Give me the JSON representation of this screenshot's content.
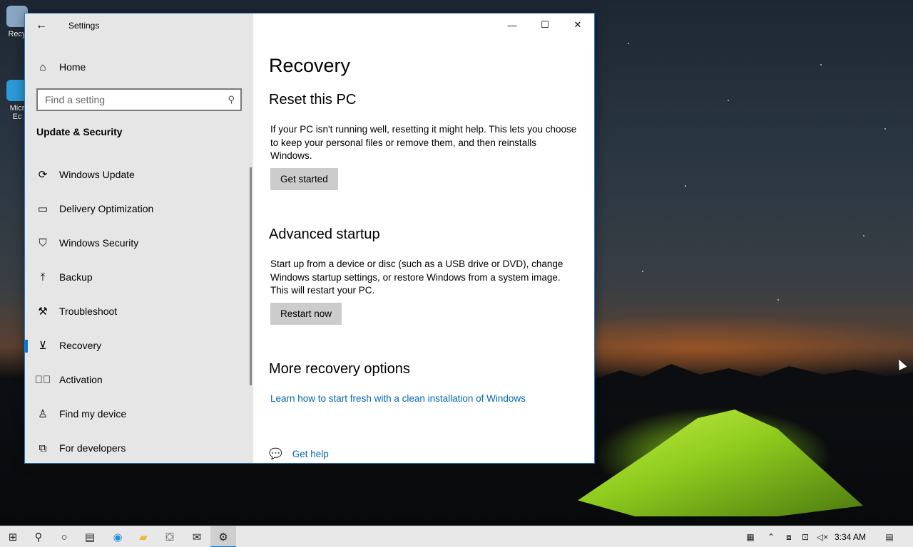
{
  "desktop": {
    "icons": [
      {
        "label": "Recy",
        "icon": "recycle-bin-icon"
      },
      {
        "label": "Micr Ec",
        "icon": "edge-shortcut-icon"
      }
    ]
  },
  "window": {
    "title": "Settings",
    "back_icon": "back-arrow-icon",
    "controls": {
      "minimize": "—",
      "maximize": "☐",
      "close": "✕"
    }
  },
  "sidebar": {
    "home_label": "Home",
    "search_placeholder": "Find a setting",
    "section_title": "Update & Security",
    "items": [
      {
        "label": "Windows Update",
        "icon": "sync-icon",
        "active": false
      },
      {
        "label": "Delivery Optimization",
        "icon": "delivery-icon",
        "active": false
      },
      {
        "label": "Windows Security",
        "icon": "shield-icon",
        "active": false
      },
      {
        "label": "Backup",
        "icon": "upload-icon",
        "active": false
      },
      {
        "label": "Troubleshoot",
        "icon": "wrench-icon",
        "active": false
      },
      {
        "label": "Recovery",
        "icon": "recovery-icon",
        "active": true
      },
      {
        "label": "Activation",
        "icon": "check-circle-icon",
        "active": false
      },
      {
        "label": "Find my device",
        "icon": "person-location-icon",
        "active": false
      },
      {
        "label": "For developers",
        "icon": "developer-icon",
        "active": false
      }
    ]
  },
  "main": {
    "page_title": "Recovery",
    "reset": {
      "heading": "Reset this PC",
      "description": "If your PC isn't running well, resetting it might help. This lets you choose to keep your personal files or remove them, and then reinstalls Windows.",
      "button": "Get started"
    },
    "advanced": {
      "heading": "Advanced startup",
      "description": "Start up from a device or disc (such as a USB drive or DVD), change Windows startup settings, or restore Windows from a system image. This will restart your PC.",
      "button": "Restart now"
    },
    "more": {
      "heading": "More recovery options",
      "link": "Learn how to start fresh with a clean installation of Windows"
    },
    "help_link": "Get help"
  },
  "taskbar": {
    "clock": "3:34 AM",
    "accent": "#0078d7"
  }
}
